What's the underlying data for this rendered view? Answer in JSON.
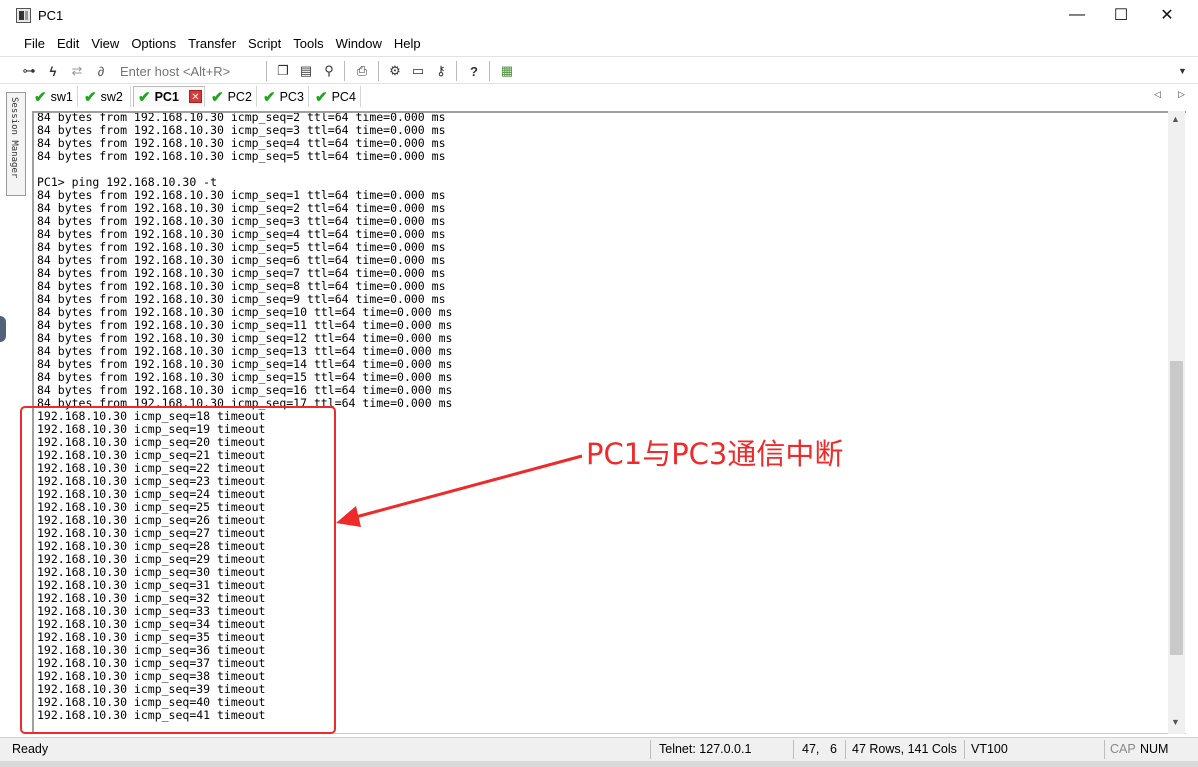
{
  "window": {
    "title": "PC1",
    "min_symbol": "—",
    "max_symbol": "☐",
    "close_symbol": "✕",
    "app_icon": "securecrt-window-icon"
  },
  "menu": [
    "File",
    "Edit",
    "View",
    "Options",
    "Transfer",
    "Script",
    "Tools",
    "Window",
    "Help"
  ],
  "toolbar": {
    "host_placeholder": "Enter host <Alt+R>",
    "icons": [
      "connect-icon",
      "lightning-icon",
      "reconnect-icon",
      "disconnect-icon",
      "copy-icon",
      "paste-icon",
      "find-icon",
      "print-icon",
      "settings-icon",
      "keymap-icon",
      "key-icon",
      "help-icon",
      "sftp-icon"
    ]
  },
  "side_panel": {
    "label": "Session Manager"
  },
  "tabs": [
    {
      "label": "sw1",
      "status": "connected",
      "active": false
    },
    {
      "label": "sw2",
      "status": "connected",
      "active": false
    },
    {
      "label": "PC1",
      "status": "connected",
      "active": true
    },
    {
      "label": "PC2",
      "status": "connected",
      "active": false
    },
    {
      "label": "PC3",
      "status": "connected",
      "active": false
    },
    {
      "label": "PC4",
      "status": "connected",
      "active": false
    }
  ],
  "tab_nav": {
    "prev": "◁",
    "next": "▷"
  },
  "terminal": {
    "lines": [
      "84 bytes from 192.168.10.30 icmp_seq=2 ttl=64 time=0.000 ms",
      "84 bytes from 192.168.10.30 icmp_seq=3 ttl=64 time=0.000 ms",
      "84 bytes from 192.168.10.30 icmp_seq=4 ttl=64 time=0.000 ms",
      "84 bytes from 192.168.10.30 icmp_seq=5 ttl=64 time=0.000 ms",
      "",
      "PC1> ping 192.168.10.30 -t",
      "84 bytes from 192.168.10.30 icmp_seq=1 ttl=64 time=0.000 ms",
      "84 bytes from 192.168.10.30 icmp_seq=2 ttl=64 time=0.000 ms",
      "84 bytes from 192.168.10.30 icmp_seq=3 ttl=64 time=0.000 ms",
      "84 bytes from 192.168.10.30 icmp_seq=4 ttl=64 time=0.000 ms",
      "84 bytes from 192.168.10.30 icmp_seq=5 ttl=64 time=0.000 ms",
      "84 bytes from 192.168.10.30 icmp_seq=6 ttl=64 time=0.000 ms",
      "84 bytes from 192.168.10.30 icmp_seq=7 ttl=64 time=0.000 ms",
      "84 bytes from 192.168.10.30 icmp_seq=8 ttl=64 time=0.000 ms",
      "84 bytes from 192.168.10.30 icmp_seq=9 ttl=64 time=0.000 ms",
      "84 bytes from 192.168.10.30 icmp_seq=10 ttl=64 time=0.000 ms",
      "84 bytes from 192.168.10.30 icmp_seq=11 ttl=64 time=0.000 ms",
      "84 bytes from 192.168.10.30 icmp_seq=12 ttl=64 time=0.000 ms",
      "84 bytes from 192.168.10.30 icmp_seq=13 ttl=64 time=0.000 ms",
      "84 bytes from 192.168.10.30 icmp_seq=14 ttl=64 time=0.000 ms",
      "84 bytes from 192.168.10.30 icmp_seq=15 ttl=64 time=0.000 ms",
      "84 bytes from 192.168.10.30 icmp_seq=16 ttl=64 time=0.000 ms",
      "84 bytes from 192.168.10.30 icmp_seq=17 ttl=64 time=0.000 ms",
      "192.168.10.30 icmp_seq=18 timeout",
      "192.168.10.30 icmp_seq=19 timeout",
      "192.168.10.30 icmp_seq=20 timeout",
      "192.168.10.30 icmp_seq=21 timeout",
      "192.168.10.30 icmp_seq=22 timeout",
      "192.168.10.30 icmp_seq=23 timeout",
      "192.168.10.30 icmp_seq=24 timeout",
      "192.168.10.30 icmp_seq=25 timeout",
      "192.168.10.30 icmp_seq=26 timeout",
      "192.168.10.30 icmp_seq=27 timeout",
      "192.168.10.30 icmp_seq=28 timeout",
      "192.168.10.30 icmp_seq=29 timeout",
      "192.168.10.30 icmp_seq=30 timeout",
      "192.168.10.30 icmp_seq=31 timeout",
      "192.168.10.30 icmp_seq=32 timeout",
      "192.168.10.30 icmp_seq=33 timeout",
      "192.168.10.30 icmp_seq=34 timeout",
      "192.168.10.30 icmp_seq=35 timeout",
      "192.168.10.30 icmp_seq=36 timeout",
      "192.168.10.30 icmp_seq=37 timeout",
      "192.168.10.30 icmp_seq=38 timeout",
      "192.168.10.30 icmp_seq=39 timeout",
      "192.168.10.30 icmp_seq=40 timeout",
      "192.168.10.30 icmp_seq=41 timeout"
    ]
  },
  "annotation": {
    "text": "PC1与PC3通信中断",
    "color": "#ee2a2a"
  },
  "status": {
    "ready": "Ready",
    "connection": "Telnet: 127.0.0.1",
    "cursor_row": "47,",
    "cursor_col": "6",
    "size": "47 Rows, 141 Cols",
    "terminal_type": "VT100",
    "cap": "CAP",
    "num": "NUM"
  },
  "colors": {
    "check_green": "#1fa61f",
    "tab_close_red": "#d33b3b"
  }
}
